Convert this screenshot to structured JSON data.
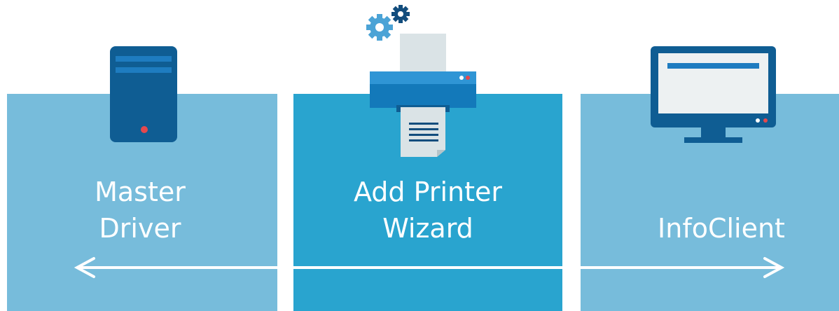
{
  "colors": {
    "panel_side": "#77bcdb",
    "panel_center": "#29a4cf",
    "dark_blue": "#0f5d93",
    "mid_blue": "#1379ba",
    "gear_light": "#4ba3d6",
    "gear_dark": "#124d7d",
    "screen": "#edf1f2",
    "paper": "#dae3e6",
    "red_dot": "#e5484d",
    "white": "#ffffff"
  },
  "labels": {
    "master": [
      "Master",
      "Driver"
    ],
    "wizard": [
      "Add Printer",
      "Wizard"
    ],
    "client": "InfoClient"
  },
  "icons": {
    "left": "server-icon",
    "center": "printer-icon",
    "right": "monitor-icon",
    "gears": "gears-icon"
  }
}
